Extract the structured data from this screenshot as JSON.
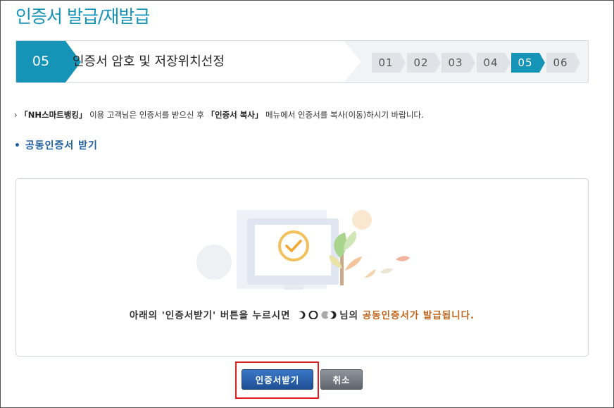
{
  "page": {
    "title": "인증서 발급/재발급"
  },
  "stepbar": {
    "current_number": "05",
    "current_title": "인증서 암호 및 저장위치선정",
    "steps": [
      "01",
      "02",
      "03",
      "04",
      "05",
      "06"
    ],
    "active_step": "05"
  },
  "notice": {
    "bullet": "›",
    "part1": "「NH스마트뱅킹」",
    "part2": " 이용 고객님은 인증서를 받으신 후 ",
    "part3": "「인증서 복사」",
    "part4": " 메뉴에서 인증서를 복사(이동)하시기 바랍니다."
  },
  "section": {
    "title": "• 공동인증서 받기"
  },
  "message": {
    "before": "아래의 '인증서받기' 버튼을 누르시면 ",
    "after": "님의 ",
    "highlight": "공동인증서가 발급됩니다."
  },
  "buttons": {
    "receive_label": "인증서받기",
    "cancel_label": "취소"
  },
  "colors": {
    "accent": "#1694b8",
    "highlight_text": "#c0661e",
    "primary_button": "#2a5fa8",
    "annotation_frame": "#e01c1c"
  }
}
